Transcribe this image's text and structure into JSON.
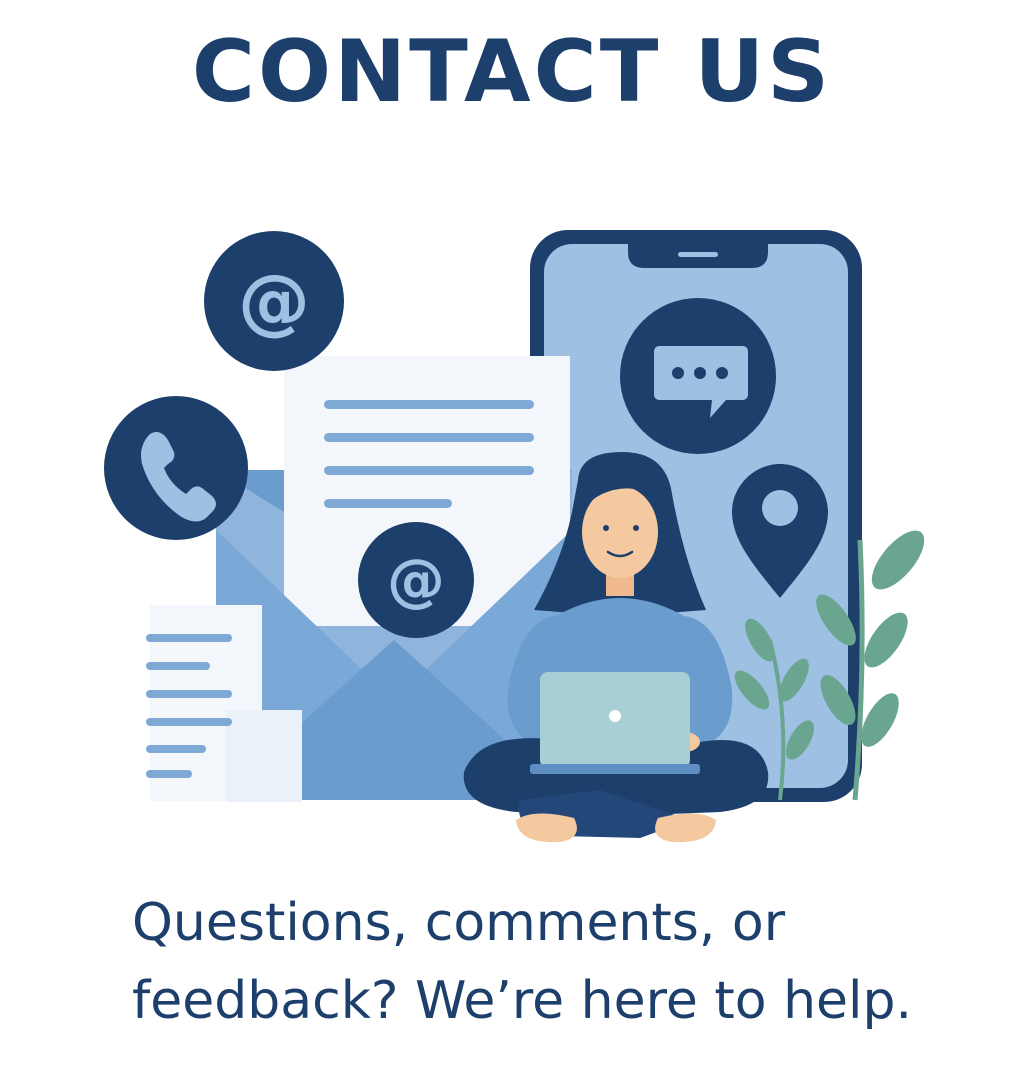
{
  "title": "CONTACT US",
  "tagline": {
    "line1": "Questions, comments, or",
    "line2": "feedback? We’re here to help."
  },
  "icons": [
    "at-sign-icon",
    "phone-icon",
    "chat-bubble-icon",
    "location-pin-icon",
    "envelope-icon",
    "document-icon",
    "smartphone-icon",
    "laptop-icon"
  ],
  "colors": {
    "navy": "#1d3f6b",
    "light_blue": "#9ec0e2",
    "mid_blue": "#6a9ccd",
    "paper": "#f3f7fc",
    "leaf": "#6aa590",
    "skin": "#f5c9a0"
  }
}
